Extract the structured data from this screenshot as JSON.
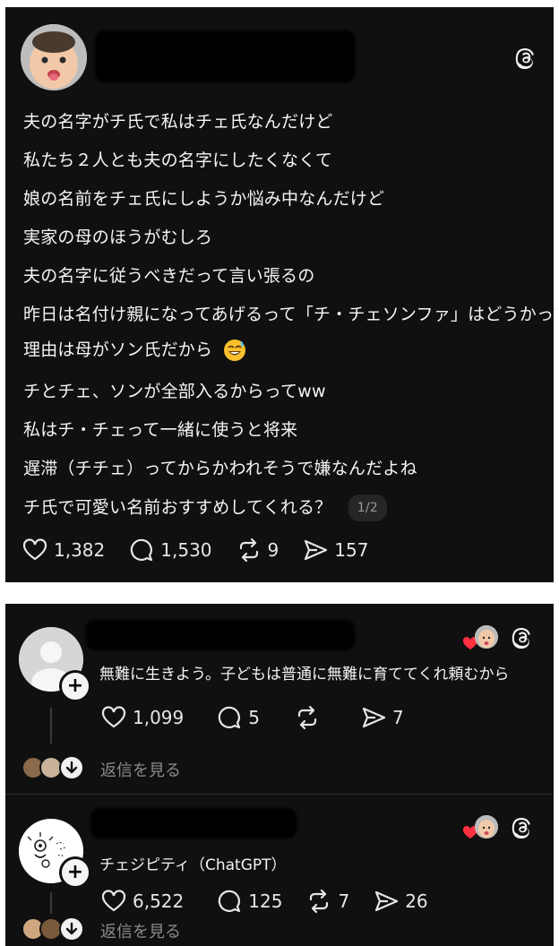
{
  "post": {
    "lines": [
      "夫の名字がチ氏で私はチェ氏なんだけど",
      "私たち２人とも夫の名字にしたくなくて",
      "娘の名前をチェ氏にしようか悩み中なんだけど",
      "実家の母のほうがむしろ",
      "夫の名字に従うべきだって言い張るの",
      "昨日は名付け親になってあげるって「チ・チェソンファ」はどうかって",
      "理由は母がソン氏だから",
      "チとチェ、ソンが全部入るからってww",
      "私はチ・チェって一緒に使うと将来",
      "遅滞（チチェ）ってからかわれそうで嫌なんだよね",
      "チ氏で可愛い名前おすすめしてくれる？"
    ],
    "page_badge": "1/2",
    "likes": "1,382",
    "comments": "1,530",
    "reposts": "9",
    "shares": "157",
    "emoji_icon": "sweat-smile-emoji"
  },
  "replies": [
    {
      "text": "無難に生きよう。子どもは普通に無難に育ててくれ頼むから",
      "likes": "1,099",
      "comments": "5",
      "reposts": "",
      "shares": "7",
      "view_replies": "返信を見る"
    },
    {
      "text": "チェジピティ（ChatGPT）",
      "likes": "6,522",
      "comments": "125",
      "reposts": "7",
      "shares": "26",
      "view_replies": "返信を見る"
    }
  ],
  "colors": {
    "card_bg": "#101010",
    "text": "#f3f3f3",
    "muted": "#8a8a8a",
    "heart_red": "#ff3040"
  }
}
